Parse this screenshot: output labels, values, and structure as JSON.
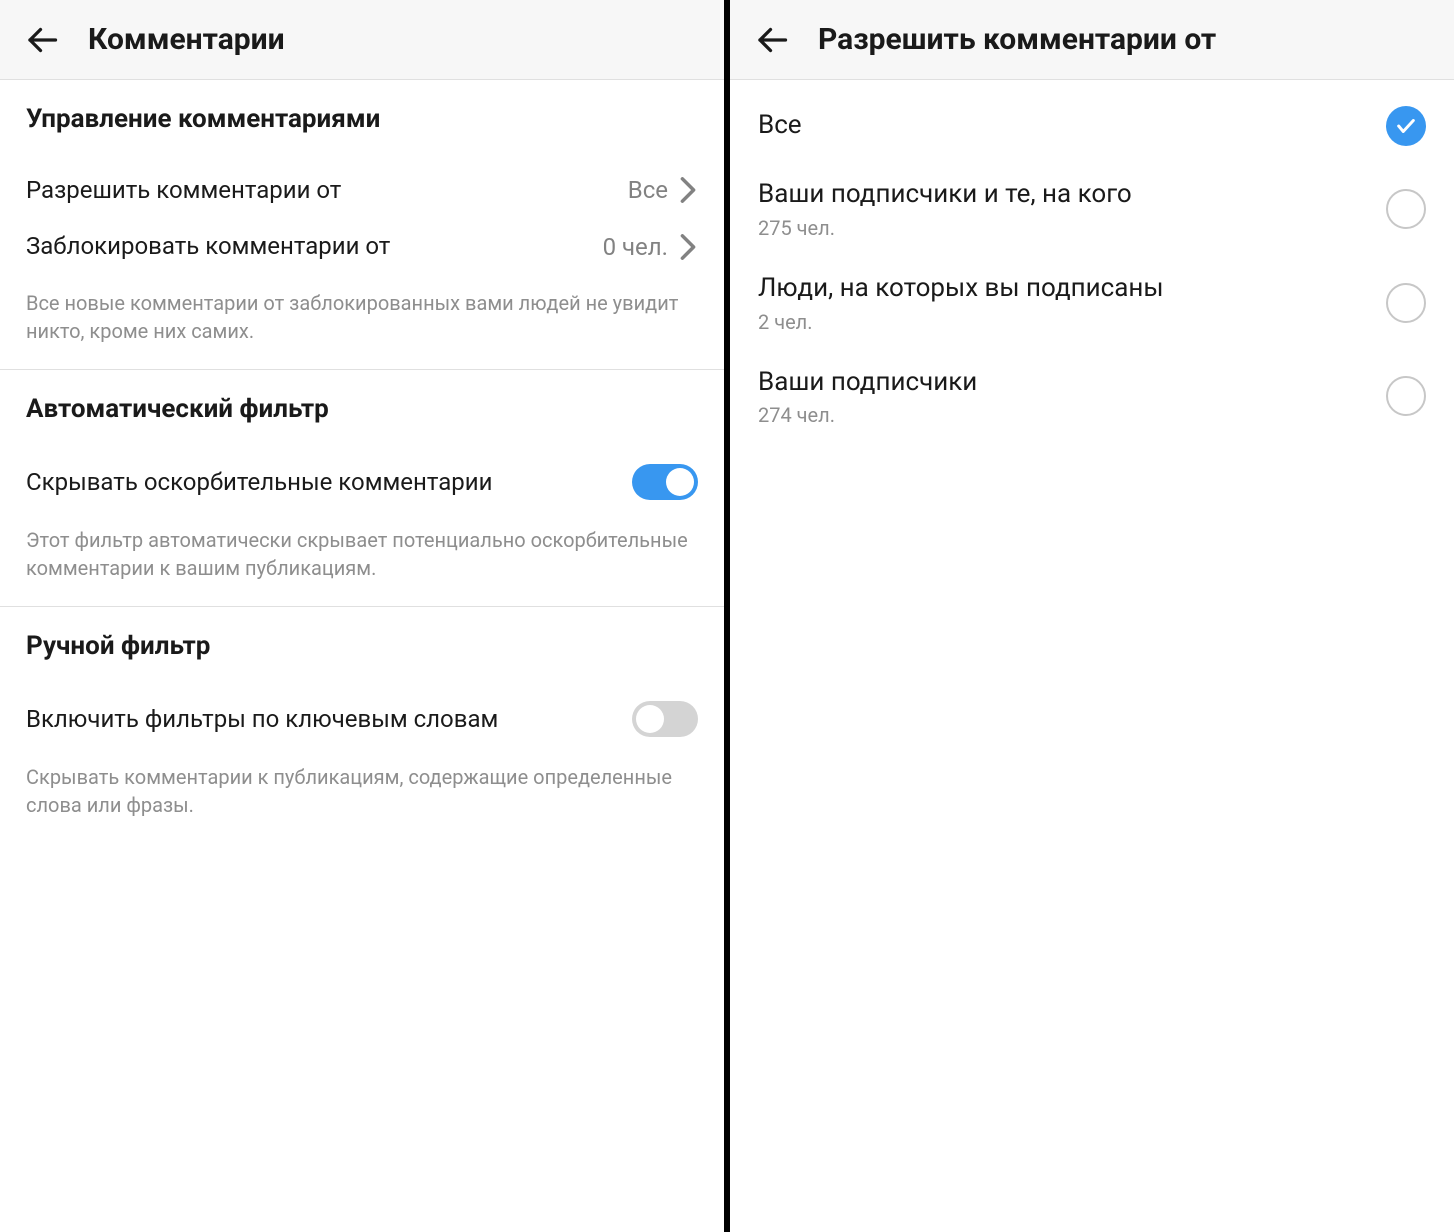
{
  "left": {
    "header": {
      "title": "Комментарии"
    },
    "sections": {
      "controls": {
        "title": "Управление комментариями",
        "allow": {
          "label": "Разрешить комментарии от",
          "value": "Все"
        },
        "block": {
          "label": "Заблокировать комментарии от",
          "value": "0 чел."
        },
        "help": "Все новые комментарии от заблокированных вами людей не увидит никто, кроме них самих."
      },
      "auto": {
        "title": "Автоматический фильтр",
        "hide": {
          "label": "Скрывать оскорбительные комментарии",
          "enabled": true
        },
        "help": "Этот фильтр автоматически скрывает потенциально оскорбительные комментарии к вашим публикациям."
      },
      "manual": {
        "title": "Ручной фильтр",
        "keywords": {
          "label": "Включить фильтры по ключевым словам",
          "enabled": false
        },
        "help": "Скрывать комментарии к публикациям, содержащие определенные слова или фразы."
      }
    }
  },
  "right": {
    "header": {
      "title": "Разрешить комментарии от"
    },
    "options": [
      {
        "label": "Все",
        "sub": "",
        "selected": true
      },
      {
        "label": "Ваши подписчики и те, на кого",
        "sub": "275 чел.",
        "selected": false
      },
      {
        "label": "Люди, на которых вы подписаны",
        "sub": "2 чел.",
        "selected": false
      },
      {
        "label": "Ваши подписчики",
        "sub": "274 чел.",
        "selected": false
      }
    ]
  },
  "colors": {
    "accent": "#3897f0",
    "text_secondary": "#8e8e8e"
  }
}
